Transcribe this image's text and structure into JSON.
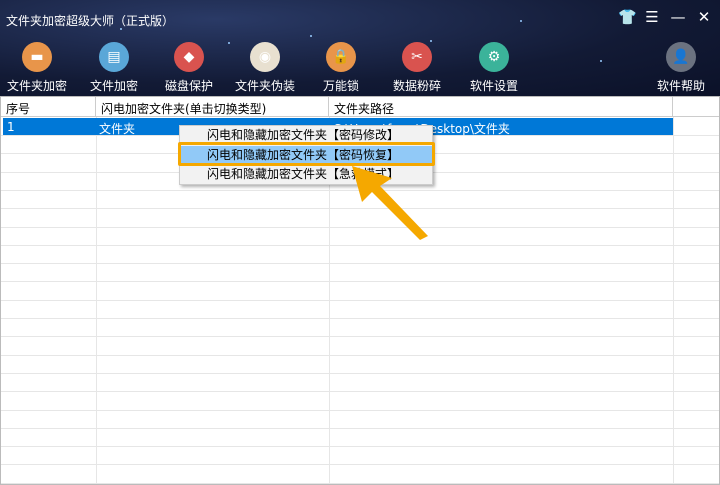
{
  "app": {
    "title": "文件夹加密超级大师（正式版）"
  },
  "window_buttons": [
    "skin",
    "menu",
    "minimize",
    "close"
  ],
  "toolbar": [
    {
      "label": "文件夹加密",
      "icon": "folder-icon",
      "color": "#e8954a"
    },
    {
      "label": "文件加密",
      "icon": "clipboard-icon",
      "color": "#5aa7d8"
    },
    {
      "label": "磁盘保护",
      "icon": "shield-icon",
      "color": "#d9534f"
    },
    {
      "label": "文件夹伪装",
      "icon": "palette-icon",
      "color": "#e8e0d0"
    },
    {
      "label": "万能锁",
      "icon": "lock-icon",
      "color": "#e8954a"
    },
    {
      "label": "数据粉碎",
      "icon": "scissors-icon",
      "color": "#d9534f"
    },
    {
      "label": "软件设置",
      "icon": "gear-icon",
      "color": "#3bb39a"
    }
  ],
  "help": {
    "label": "软件帮助",
    "icon": "user-icon",
    "color": "#6b7280"
  },
  "table": {
    "headers": [
      "序号",
      "闪电加密文件夹(单击切换类型)",
      "文件夹路径"
    ],
    "rows": [
      {
        "index": "1",
        "type": "文件夹",
        "path": "C:\\Users\\fuwu\\Desktop\\文件夹"
      }
    ]
  },
  "context_menu": {
    "items": [
      "闪电和隐藏加密文件夹【密码修改】",
      "闪电和隐藏加密文件夹【密码恢复】",
      "闪电和隐藏加密文件夹【急救模式】"
    ],
    "highlighted": 1
  },
  "colors": {
    "selection": "#0078d7",
    "highlight": "#91c9f7",
    "annotation": "#f5a800"
  }
}
